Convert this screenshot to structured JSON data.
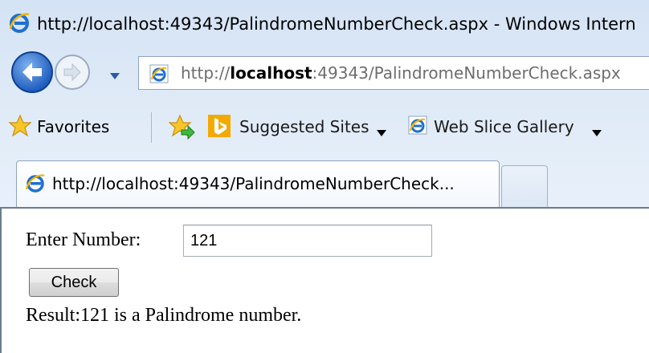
{
  "window": {
    "title": "http://localhost:49343/PalindromeNumberCheck.aspx - Windows Intern"
  },
  "navigation": {
    "address_prefix": "http://",
    "address_host": "localhost",
    "address_rest": ":49343/PalindromeNumberCheck.aspx",
    "icons": {
      "back": "back-arrow-icon",
      "forward": "forward-arrow-icon",
      "page": "ie-page-icon"
    }
  },
  "favorites_bar": {
    "favorites_label": "Favorites",
    "items": [
      {
        "label": "Suggested Sites",
        "icon": "bing-icon"
      },
      {
        "label": "Web Slice Gallery",
        "icon": "ie-page-icon"
      }
    ]
  },
  "tabs": [
    {
      "label": "http://localhost:49343/PalindromeNumberCheck...",
      "active": true
    }
  ],
  "page": {
    "enter_label": "Enter Number:",
    "number_value": "121",
    "check_label": "Check",
    "result": "Result:121 is a Palindrome number."
  },
  "colors": {
    "chrome_top": "#d4e3f5",
    "ie_blue": "#1f6fd1",
    "bing_orange": "#f2a900"
  }
}
